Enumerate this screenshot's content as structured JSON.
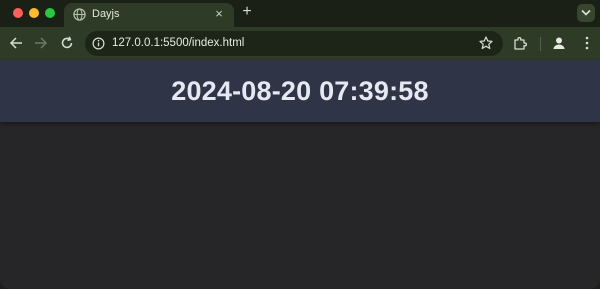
{
  "browser": {
    "tab": {
      "title": "Dayjs",
      "icon": "globe-icon",
      "close_label": "×"
    },
    "new_tab_label": "+",
    "address_bar": {
      "url": "127.0.0.1:5500/index.html"
    }
  },
  "page": {
    "datetime": "2024-08-20 07:39:58",
    "colors": {
      "header": "#2f3446",
      "body": "#262528",
      "text": "#e6e8f2"
    }
  }
}
